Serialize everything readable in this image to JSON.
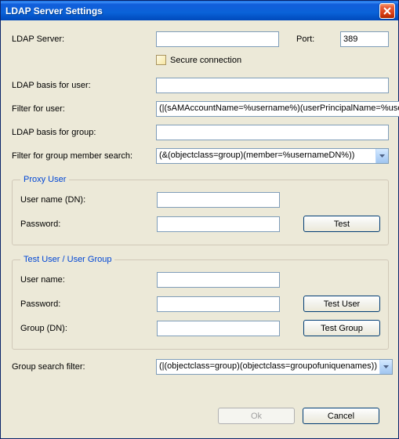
{
  "title": "LDAP Server Settings",
  "labels": {
    "ldap_server": "LDAP Server:",
    "port": "Port:",
    "secure_conn": "Secure connection",
    "ldap_basis_user": "LDAP basis for user:",
    "filter_user": "Filter for user:",
    "ldap_basis_group": "LDAP basis for group:",
    "filter_group_member": "Filter for group member search:",
    "group_search_filter": "Group search filter:"
  },
  "values": {
    "ldap_server": "",
    "port": "389",
    "secure_conn_checked": false,
    "ldap_basis_user": "",
    "filter_user": "(|(sAMAccountName=%username%)(userPrincipalName=%username%))",
    "ldap_basis_group": "",
    "filter_group_member": "(&(objectclass=group)(member=%usernameDN%))",
    "group_search_filter": "(|(objectclass=group)(objectclass=groupofuniquenames))"
  },
  "proxy": {
    "legend": "Proxy User",
    "username_label": "User name (DN):",
    "password_label": "Password:",
    "username": "",
    "password": "",
    "test_btn": "Test"
  },
  "testgroup": {
    "legend": "Test User / User Group",
    "username_label": "User name:",
    "password_label": "Password:",
    "group_label": "Group (DN):",
    "username": "",
    "password": "",
    "group": "",
    "test_user_btn": "Test User",
    "test_group_btn": "Test Group"
  },
  "buttons": {
    "ok": "Ok",
    "cancel": "Cancel"
  }
}
